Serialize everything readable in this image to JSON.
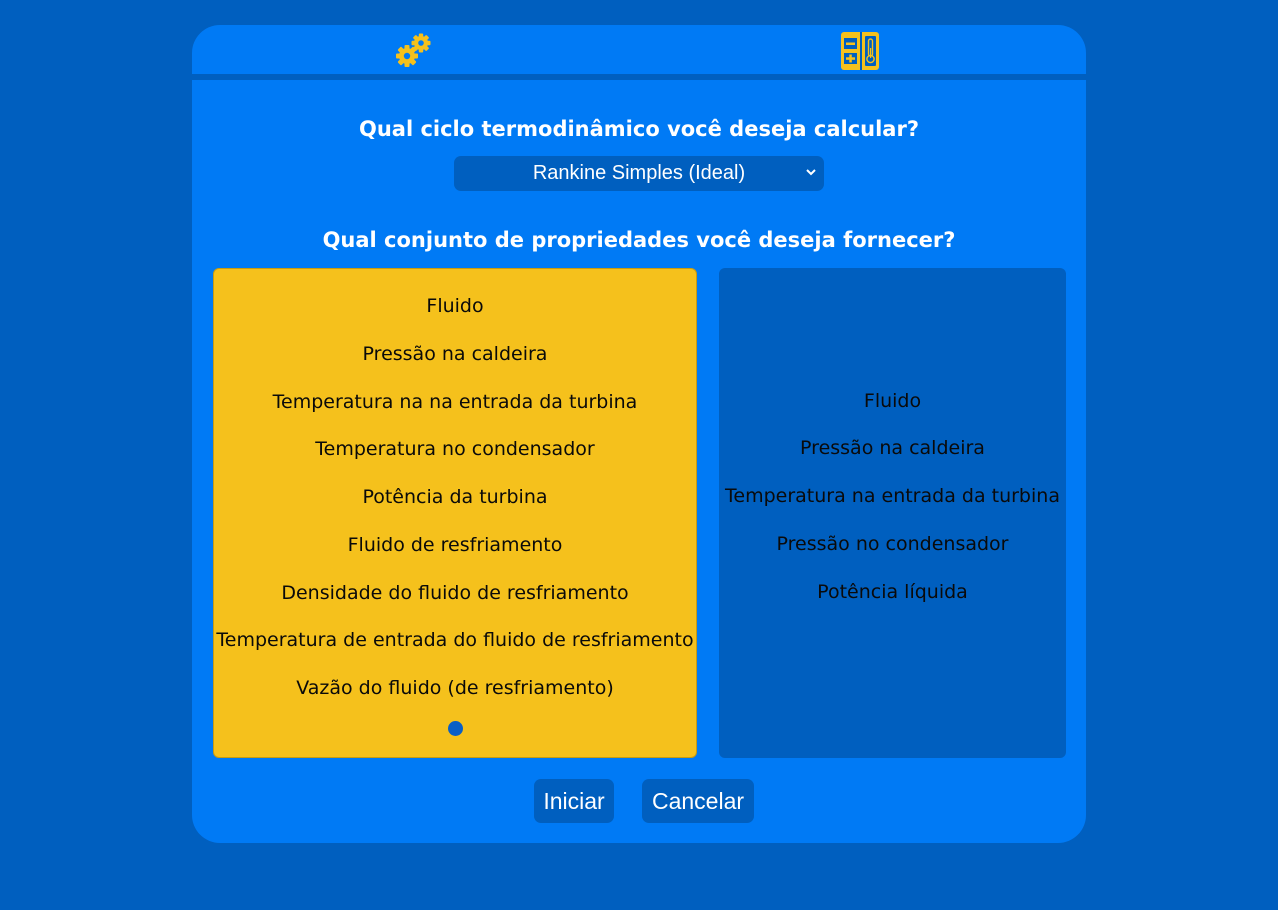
{
  "icons": {
    "config_tab": "gears-icon",
    "calc_tab": "calculator-thermometer-icon"
  },
  "colors": {
    "page_bg": "#005fbf",
    "card_bg": "#007af5",
    "selected_panel": "#f5c11c",
    "unselected_panel": "#005fbf",
    "accent_yellow": "#f5c11c"
  },
  "cycle": {
    "question": "Qual ciclo termodinâmico você deseja calcular?",
    "selected": "Rankine Simples (Ideal)"
  },
  "property_sets": {
    "question": "Qual conjunto de propriedades você deseja fornecer?",
    "options": [
      {
        "selected": true,
        "items": [
          "Fluido",
          "Pressão na caldeira",
          "Temperatura na na entrada da turbina",
          "Temperatura no condensador",
          "Potência da turbina",
          "Fluido de resfriamento",
          "Densidade do fluido de resfriamento",
          "Temperatura de entrada do fluido de resfriamento",
          "Vazão do fluido (de resfriamento)"
        ]
      },
      {
        "selected": false,
        "items": [
          "Fluido",
          "Pressão na caldeira",
          "Temperatura na entrada da turbina",
          "Pressão no condensador",
          "Potência líquida"
        ]
      }
    ]
  },
  "buttons": {
    "start_label": "Iniciar",
    "cancel_label": "Cancelar"
  }
}
